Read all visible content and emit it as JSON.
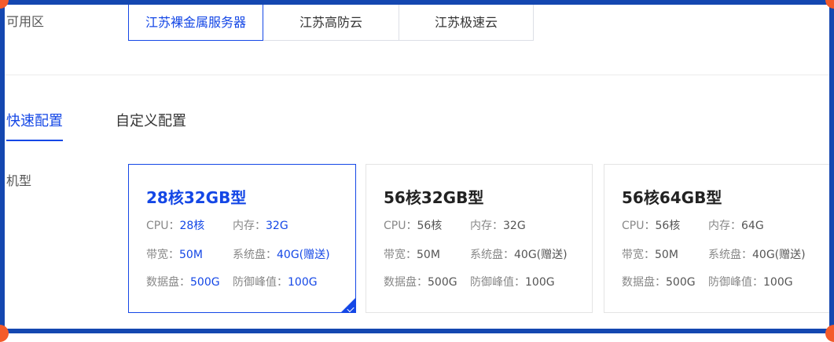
{
  "zone": {
    "label": "可用区",
    "tabs": [
      "江苏裸金属服务器",
      "江苏高防云",
      "江苏极速云"
    ],
    "active_index": 0
  },
  "config_tabs": {
    "quick": "快速配置",
    "custom": "自定义配置",
    "active": "quick"
  },
  "model": {
    "label": "机型",
    "spec_labels": {
      "cpu": "CPU：",
      "mem": "内存：",
      "bw": "带宽：",
      "sysdisk": "系统盘：",
      "datadisk": "数据盘：",
      "ddos": "防御峰值："
    },
    "cards": [
      {
        "title": "28核32GB型",
        "cpu": "28核",
        "mem": "32G",
        "bw": "50M",
        "sysdisk": "40G(赠送)",
        "datadisk": "500G",
        "ddos": "100G",
        "selected": true
      },
      {
        "title": "56核32GB型",
        "cpu": "56核",
        "mem": "32G",
        "bw": "50M",
        "sysdisk": "40G(赠送)",
        "datadisk": "500G",
        "ddos": "100G",
        "selected": false
      },
      {
        "title": "56核64GB型",
        "cpu": "56核",
        "mem": "64G",
        "bw": "50M",
        "sysdisk": "40G(赠送)",
        "datadisk": "500G",
        "ddos": "100G",
        "selected": false
      }
    ]
  },
  "colors": {
    "accent": "#1447e6",
    "frame": "#1447b0",
    "corner_handle": "#f45b2a"
  }
}
